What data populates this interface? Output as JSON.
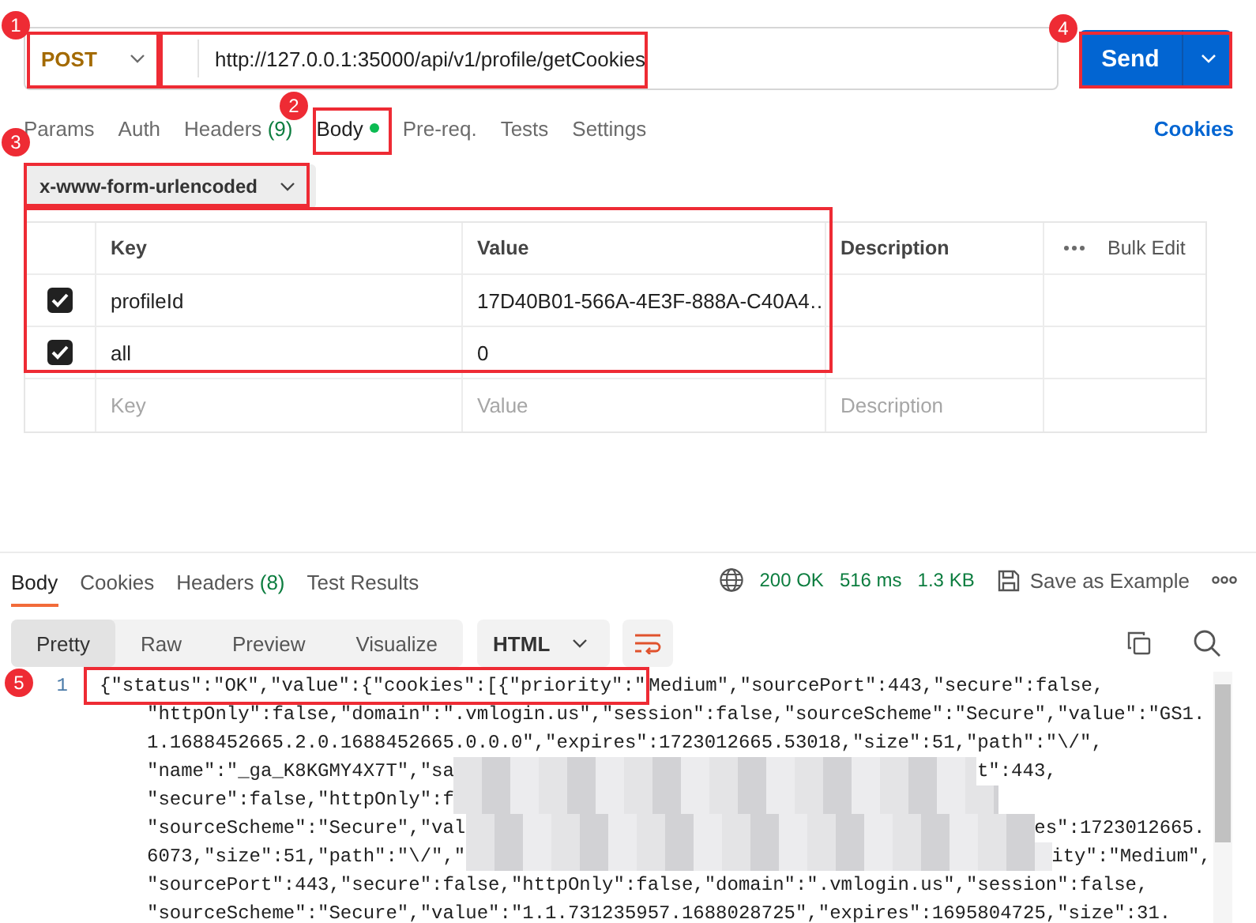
{
  "request": {
    "method": "POST",
    "url": "http://127.0.0.1:35000/api/v1/profile/getCookies",
    "send": "Send"
  },
  "request_tabs": [
    {
      "label": "Params",
      "selected": false
    },
    {
      "label": "Auth",
      "selected": false
    },
    {
      "label": "Headers",
      "count": "(9)",
      "selected": false
    },
    {
      "label": "Body",
      "has_content": true,
      "selected": true
    },
    {
      "label": "Pre-req.",
      "selected": false
    },
    {
      "label": "Tests",
      "selected": false
    },
    {
      "label": "Settings",
      "selected": false
    }
  ],
  "cookies_link": "Cookies",
  "body_type": "x-www-form-urlencoded",
  "params_table": {
    "columns": [
      "Key",
      "Value",
      "Description"
    ],
    "bulk_edit": "Bulk Edit",
    "rows": [
      {
        "checked": true,
        "key": "profileId",
        "value": "17D40B01-566A-4E3F-888A-C40A4…"
      },
      {
        "checked": true,
        "key": "all",
        "value": "0"
      }
    ],
    "placeholders": {
      "key": "Key",
      "value": "Value",
      "description": "Description"
    }
  },
  "response_tabs": [
    {
      "label": "Body",
      "selected": true
    },
    {
      "label": "Cookies",
      "selected": false
    },
    {
      "label": "Headers",
      "count": "(8)",
      "selected": false
    },
    {
      "label": "Test Results",
      "selected": false
    }
  ],
  "response_meta": {
    "status": "200 OK",
    "time": "516 ms",
    "size": "1.3 KB",
    "save": "Save as Example"
  },
  "format_tabs": [
    {
      "label": "Pretty",
      "selected": true
    },
    {
      "label": "Raw",
      "selected": false
    },
    {
      "label": "Preview",
      "selected": false
    },
    {
      "label": "Visualize",
      "selected": false
    }
  ],
  "format_language": "HTML",
  "wrap_lines": true,
  "code": {
    "line_number": "1",
    "lines": [
      {
        "segments": [
          {
            "kind": "text",
            "text": "{\"status\":\"OK\",\"value\":{\"cookies\":[{\"priority\":\"",
            "highlighted": true
          },
          {
            "kind": "text",
            "text": "Medium\",\"sourcePort\":443,\"secure\":false,"
          }
        ]
      },
      {
        "segments": [
          {
            "kind": "text",
            "text": "\"httpOnly\":false,\"domain\":\".vmlogin.us\",\"session\":false,\"sourceScheme\":\"Secure\",\"value\":\"GS1."
          }
        ]
      },
      {
        "segments": [
          {
            "kind": "text",
            "text": "1.1688452665.2.0.1688452665.0.0.0\",\"expires\":1723012665.53018,\"size\":51,\"path\":\"\\/\","
          }
        ]
      },
      {
        "segments": [
          {
            "kind": "text",
            "text": "\"name\":\"_ga_K8KGMY4X7T\",\"sa"
          },
          {
            "kind": "redacted"
          },
          {
            "kind": "text",
            "text": "t\":443,"
          }
        ]
      },
      {
        "segments": [
          {
            "kind": "text",
            "text": "\"secure\":false,\"httpOnly\":f"
          },
          {
            "kind": "redacted"
          }
        ]
      },
      {
        "segments": [
          {
            "kind": "text",
            "text": "\"sourceScheme\":\"Secure\",\"val"
          },
          {
            "kind": "redacted"
          },
          {
            "kind": "text",
            "text": "es\":1723012665."
          }
        ]
      },
      {
        "segments": [
          {
            "kind": "text",
            "text": "6073,\"size\":51,\"path\":\"\\/\",\""
          },
          {
            "kind": "redacted"
          },
          {
            "kind": "text",
            "text": "ity\":\"Medium\","
          }
        ]
      },
      {
        "segments": [
          {
            "kind": "text",
            "text": "\"sourcePort\":443,\"secure\":false,\"httpOnly\":false,\"domain\":\".vmlogin.us\",\"session\":false,"
          }
        ]
      },
      {
        "segments": [
          {
            "kind": "text",
            "text": "\"sourceScheme\":\"Secure\",\"value\":\"1.1.731235957.1688028725\",\"expires\":1695804725,\"size\":31."
          }
        ]
      }
    ]
  },
  "annotations": [
    {
      "label": "1"
    },
    {
      "label": "2"
    },
    {
      "label": "3"
    },
    {
      "label": "4"
    },
    {
      "label": "5"
    }
  ]
}
